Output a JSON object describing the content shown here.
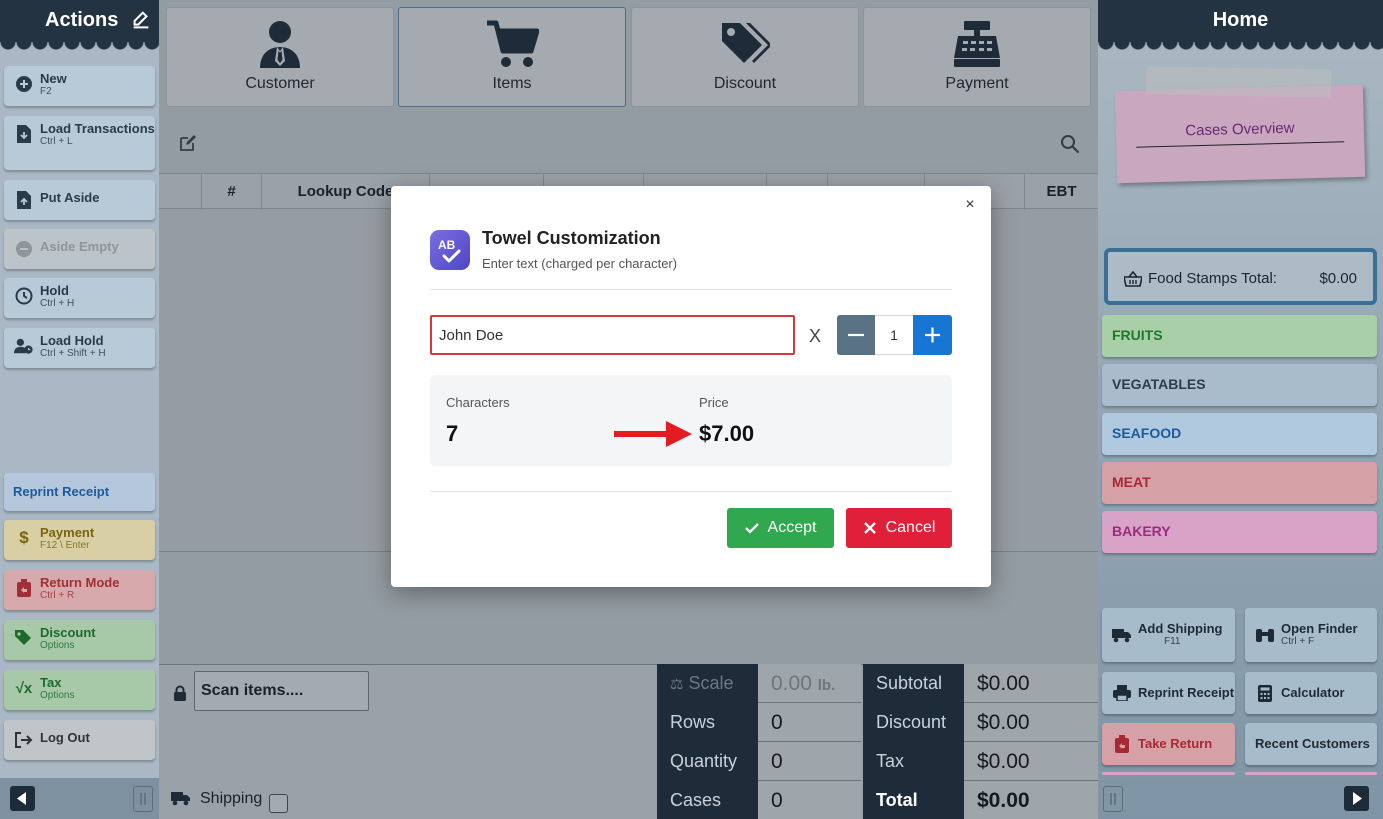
{
  "left_sidebar": {
    "title": "Actions",
    "buttons": [
      {
        "label": "New",
        "shortcut": "F2"
      },
      {
        "label": "Load Transactions",
        "shortcut": "Ctrl + L"
      },
      {
        "label": "Put Aside",
        "shortcut": ""
      },
      {
        "label": "Aside Empty",
        "shortcut": ""
      },
      {
        "label": "Hold",
        "shortcut": "Ctrl + H"
      },
      {
        "label": "Load Hold",
        "shortcut": "Ctrl + Shift + H"
      }
    ],
    "reprint_receipt": "Reprint Receipt",
    "bottom_buttons": [
      {
        "label": "Payment",
        "shortcut": "F12 \\ Enter"
      },
      {
        "label": "Return Mode",
        "shortcut": "Ctrl + R"
      },
      {
        "label": "Discount",
        "shortcut": "Options"
      },
      {
        "label": "Tax",
        "shortcut": "Options"
      },
      {
        "label": "Log Out",
        "shortcut": ""
      }
    ]
  },
  "top_tabs": [
    {
      "label": "Customer"
    },
    {
      "label": "Items",
      "active": true
    },
    {
      "label": "Discount"
    },
    {
      "label": "Payment"
    }
  ],
  "grid": {
    "columns": [
      "#",
      "Lookup Code",
      "",
      "",
      "",
      "",
      "",
      "EBT"
    ]
  },
  "scan": {
    "placeholder": "Scan items...."
  },
  "shipping": {
    "label": "Shipping"
  },
  "totals": {
    "left": [
      {
        "label": "Scale",
        "value": "0.00",
        "unit": "lb."
      },
      {
        "label": "Rows",
        "value": "0"
      },
      {
        "label": "Quantity",
        "value": "0"
      },
      {
        "label": "Cases",
        "value": "0"
      }
    ],
    "right": [
      {
        "label": "Subtotal",
        "value": "$0.00"
      },
      {
        "label": "Discount",
        "value": "$0.00"
      },
      {
        "label": "Tax",
        "value": "$0.00"
      },
      {
        "label": "Total",
        "value": "$0.00"
      }
    ]
  },
  "right_sidebar": {
    "title": "Home",
    "sticky_note": "Cases Overview",
    "food_stamps": {
      "label": "Food Stamps Total:",
      "value": "$0.00"
    },
    "categories": [
      {
        "label": "FRUITS",
        "bg": "#a9cfa9",
        "color": "#1c7a2a"
      },
      {
        "label": "VEGATABLES",
        "bg": "#a9bccb",
        "color": "#2c3d4d"
      },
      {
        "label": "SEAFOOD",
        "bg": "#b1c9df",
        "color": "#1d5a9a"
      },
      {
        "label": "MEAT",
        "bg": "#d6a1a6",
        "color": "#a62a34"
      },
      {
        "label": "BAKERY",
        "bg": "#d8a3c7",
        "color": "#9a2c7f"
      }
    ],
    "buttons": [
      {
        "label": "Add Shipping",
        "shortcut": "F11"
      },
      {
        "label": "Open Finder",
        "shortcut": "Ctrl + F"
      },
      {
        "label": "Reprint Receipt",
        "shortcut": ""
      },
      {
        "label": "Calculator",
        "shortcut": ""
      },
      {
        "label": "Take Return",
        "shortcut": ""
      },
      {
        "label": "Recent Customers",
        "shortcut": ""
      }
    ]
  },
  "modal": {
    "title": "Towel Customization",
    "subtitle": "Enter text (charged per character)",
    "text_value": "John Doe",
    "multiplier": "X",
    "quantity": "1",
    "characters_label": "Characters",
    "characters_value": "7",
    "price_label": "Price",
    "price_value": "$7.00",
    "accept_label": "Accept",
    "cancel_label": "Cancel",
    "close_label": "×"
  }
}
